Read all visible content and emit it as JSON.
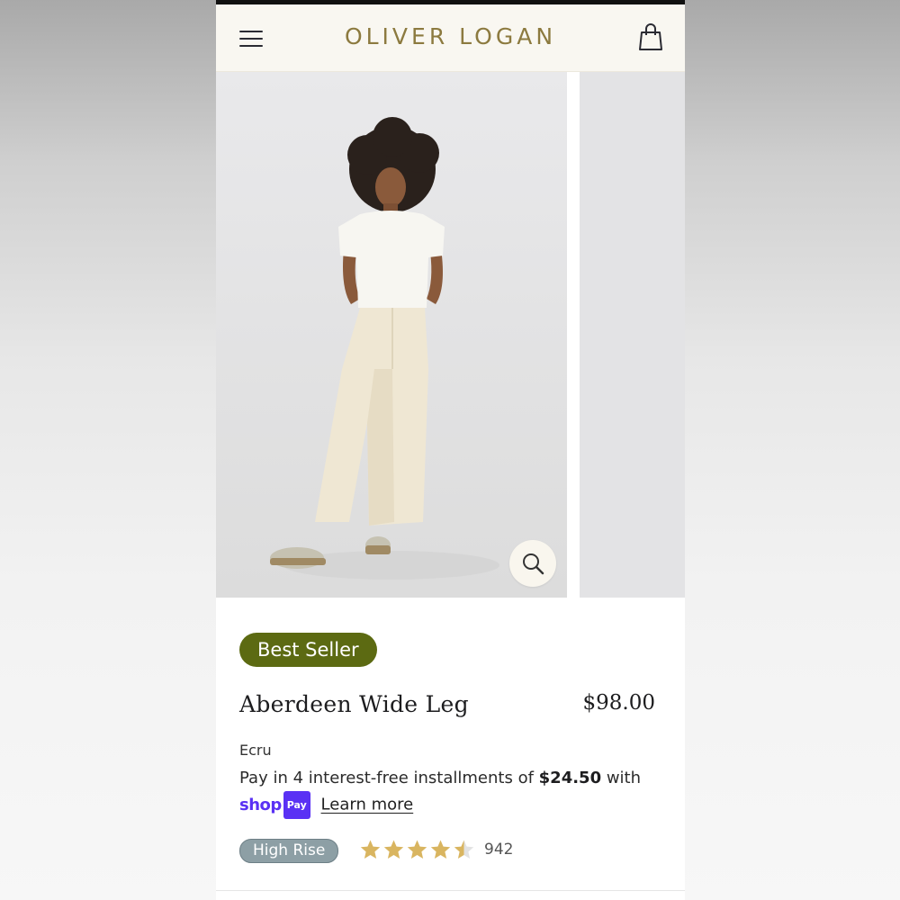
{
  "header": {
    "brand": "OLIVER LOGAN",
    "menu_icon": "hamburger-menu-icon",
    "cart_icon": "shopping-bag-icon"
  },
  "gallery": {
    "zoom_icon": "magnifier-icon",
    "image_alt": "Model wearing white tee and ecru wide leg jeans"
  },
  "product": {
    "badge": "Best Seller",
    "title": "Aberdeen Wide Leg",
    "price": "$98.00",
    "color": "Ecru",
    "installments_prefix": "Pay in 4 interest-free installments of ",
    "installment_amount": "$24.50",
    "installments_suffix": " with",
    "shop_word": "shop",
    "shop_pay_tag": "Pay",
    "learn_more": "Learn more",
    "fit_badge": "High Rise",
    "rating": 4.5,
    "review_count": "942"
  },
  "colors": {
    "brand": "#8c7a3f",
    "best_seller_bg": "#5c6a12",
    "shop_pay": "#5a31f4",
    "fit_badge_bg": "#8d9fa5",
    "star": "#d9b560"
  }
}
